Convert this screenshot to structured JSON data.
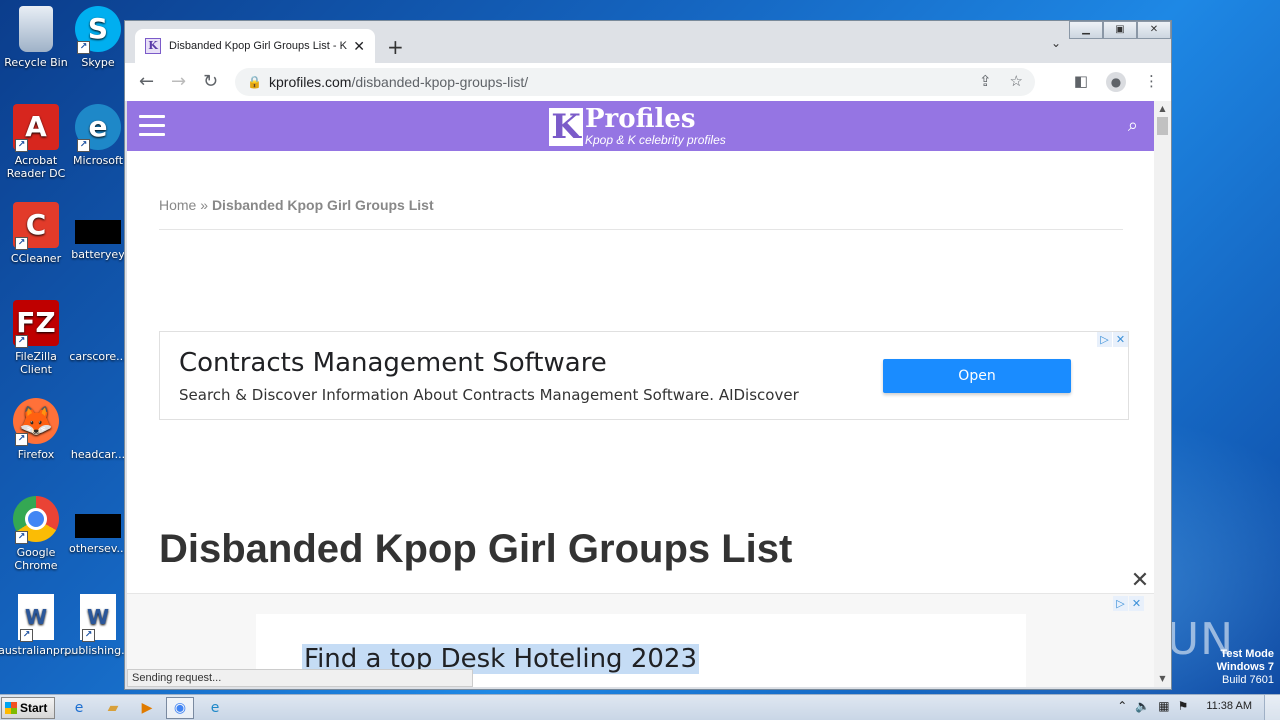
{
  "desktop": {
    "icons": [
      {
        "label": "Recycle Bin",
        "glyph": "🗑",
        "icon": "recycle-bin-icon"
      },
      {
        "label": "Skype",
        "glyph": "S",
        "icon": "skype-icon",
        "color": "#00aff0"
      },
      {
        "label": "Acrobat Reader DC",
        "glyph": "A",
        "icon": "acrobat-icon",
        "color": "#d7261e"
      },
      {
        "label": "Microsoft",
        "glyph": "e",
        "icon": "edge-icon",
        "color": "#1e88c8"
      },
      {
        "label": "CCleaner",
        "glyph": "C",
        "icon": "ccleaner-icon",
        "color": "#e23b2a"
      },
      {
        "label": "batteryey",
        "glyph": "",
        "icon": "black-file-icon",
        "color": "#000000"
      },
      {
        "label": "FileZilla Client",
        "glyph": "FZ",
        "icon": "filezilla-icon",
        "color": "#bf0000"
      },
      {
        "label": "carscore...",
        "glyph": "",
        "icon": "blank-file-icon",
        "color": "#1565c0"
      },
      {
        "label": "Firefox",
        "glyph": "🦊",
        "icon": "firefox-icon",
        "color": "#ff7139"
      },
      {
        "label": "headcar...",
        "glyph": "",
        "icon": "blank-file-icon",
        "color": "#1565c0"
      },
      {
        "label": "Google Chrome",
        "glyph": "",
        "icon": "chrome-icon",
        "color": "#4285f4"
      },
      {
        "label": "othersev...",
        "glyph": "",
        "icon": "black-file-icon",
        "color": "#000000"
      },
      {
        "label": "australianpr...",
        "glyph": "W",
        "icon": "word-doc-icon",
        "color": "#2b579a"
      },
      {
        "label": "publishing...",
        "glyph": "W",
        "icon": "word-doc-icon",
        "color": "#2b579a"
      }
    ],
    "watermark": "ANY RUN",
    "test_mode": {
      "line1": "Test Mode",
      "line2": "Windows 7",
      "line3": "Build 7601"
    }
  },
  "browser": {
    "tab_title": "Disbanded Kpop Girl Groups List - Kp",
    "tab_favicon": "K",
    "new_tab": "+",
    "url_domain": "kprofiles.com",
    "url_path": "/disbanded-kpop-groups-list/",
    "status": "Sending request..."
  },
  "site": {
    "logo_letter": "K",
    "logo_name": "Profiles",
    "logo_tagline": "Kpop & K celebrity profiles",
    "breadcrumb_home": "Home",
    "breadcrumb_sep": " » ",
    "breadcrumb_current": "Disbanded Kpop Girl Groups List",
    "ad1": {
      "headline": "Contracts Management Software",
      "description": "Search & Discover Information About Contracts Management Software. AIDiscover",
      "button": "Open"
    },
    "page_title": "Disbanded Kpop Girl Groups List",
    "bottom_ad": {
      "headline": "Find a top Desk Hoteling 2023"
    }
  },
  "taskbar": {
    "start": "Start",
    "clock": "11:38 AM"
  }
}
